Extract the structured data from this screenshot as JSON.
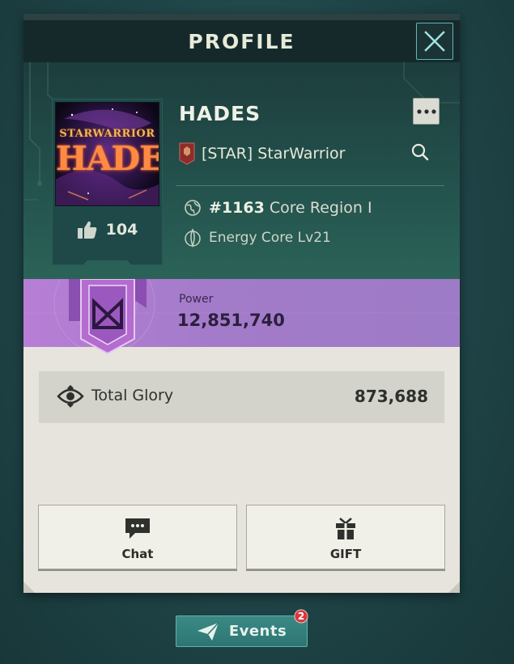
{
  "header": {
    "title": "PROFILE",
    "close_icon": "close-icon"
  },
  "player": {
    "name": "HADES",
    "avatar_subtitle": "STARWARRIOR",
    "avatar_title": "HADES",
    "likes": "104",
    "alliance": "[STAR] StarWarrior",
    "rank_number": "#1163",
    "rank_region": "Core Region I",
    "energy_core": "Energy Core Lv21"
  },
  "power": {
    "label": "Power",
    "value": "12,851,740"
  },
  "glory": {
    "label": "Total Glory",
    "value": "873,688"
  },
  "actions": {
    "chat_label": "Chat",
    "gift_label": "GIFT"
  },
  "events": {
    "label": "Events",
    "badge_count": "2"
  },
  "colors": {
    "panel_bg": "#e6e4dc",
    "header_bg": "#15292b",
    "accent_teal": "#5fb8b6",
    "power_band": "#b77ed5",
    "badge_red": "#d9373b"
  }
}
